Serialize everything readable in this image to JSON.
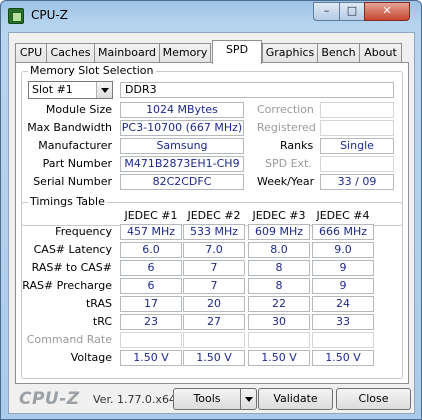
{
  "window": {
    "title": "CPU-Z",
    "minimize_label": "–",
    "maximize_label": "□",
    "close_label": "✕"
  },
  "tabs": [
    {
      "label": "CPU"
    },
    {
      "label": "Caches"
    },
    {
      "label": "Mainboard"
    },
    {
      "label": "Memory"
    },
    {
      "label": "SPD"
    },
    {
      "label": "Graphics"
    },
    {
      "label": "Bench"
    },
    {
      "label": "About"
    }
  ],
  "active_tab": "SPD",
  "memory_slot": {
    "legend": "Memory Slot Selection",
    "slot_select": "Slot #1",
    "type": "DDR3",
    "rows": {
      "module_size": {
        "label": "Module Size",
        "value": "1024 MBytes"
      },
      "max_bandwidth": {
        "label": "Max Bandwidth",
        "value": "PC3-10700 (667 MHz)"
      },
      "manufacturer": {
        "label": "Manufacturer",
        "value": "Samsung"
      },
      "part_number": {
        "label": "Part Number",
        "value": "M471B2873EH1-CH9"
      },
      "serial_number": {
        "label": "Serial Number",
        "value": "82C2CDFC"
      }
    },
    "right": {
      "correction": {
        "label": "Correction",
        "value": ""
      },
      "registered": {
        "label": "Registered",
        "value": ""
      },
      "ranks": {
        "label": "Ranks",
        "value": "Single"
      },
      "spd_ext": {
        "label": "SPD Ext.",
        "value": ""
      },
      "week_year": {
        "label": "Week/Year",
        "value": "33 / 09"
      }
    }
  },
  "timings": {
    "legend": "Timings Table",
    "columns": [
      "JEDEC #1",
      "JEDEC #2",
      "JEDEC #3",
      "JEDEC #4"
    ],
    "rows": [
      {
        "label": "Frequency",
        "values": [
          "457 MHz",
          "533 MHz",
          "609 MHz",
          "666 MHz"
        ]
      },
      {
        "label": "CAS# Latency",
        "values": [
          "6.0",
          "7.0",
          "8.0",
          "9.0"
        ]
      },
      {
        "label": "RAS# to CAS#",
        "values": [
          "6",
          "7",
          "8",
          "9"
        ]
      },
      {
        "label": "RAS# Precharge",
        "values": [
          "6",
          "7",
          "8",
          "9"
        ]
      },
      {
        "label": "tRAS",
        "values": [
          "17",
          "20",
          "22",
          "24"
        ]
      },
      {
        "label": "tRC",
        "values": [
          "23",
          "27",
          "30",
          "33"
        ]
      },
      {
        "label": "Command Rate",
        "values": [
          "",
          "",
          "",
          ""
        ]
      },
      {
        "label": "Voltage",
        "values": [
          "1.50 V",
          "1.50 V",
          "1.50 V",
          "1.50 V"
        ]
      }
    ]
  },
  "footer": {
    "brand": "CPU-Z",
    "version": "Ver. 1.77.0.x64",
    "tools_label": "Tools",
    "validate_label": "Validate",
    "close_label": "Close"
  }
}
